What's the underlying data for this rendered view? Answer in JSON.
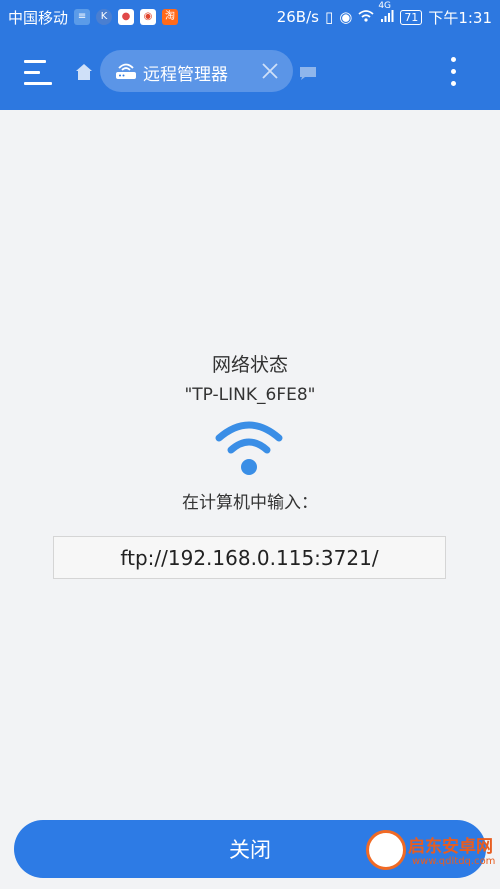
{
  "status_bar": {
    "carrier": "中国移动",
    "speed": "26B/s",
    "battery": "71",
    "time": "下午1:31",
    "network": "4G"
  },
  "toolbar": {
    "tab_title": "远程管理器"
  },
  "content": {
    "title": "网络状态",
    "ssid": "\"TP-LINK_6FE8\"",
    "instruction": "在计算机中输入：",
    "ftp_address": "ftp://192.168.0.115:3721/"
  },
  "footer": {
    "close_label": "关闭"
  },
  "watermark": {
    "name": "启东安卓网",
    "url": "www.qdltdq.com"
  },
  "colors": {
    "primary": "#2d78e0",
    "wifi": "#3a8ee6",
    "background": "#f2f3f5"
  },
  "icons": [
    "menu-icon",
    "home-icon",
    "router-icon",
    "close-icon",
    "chat-icon",
    "more-vert-icon",
    "wifi-icon"
  ]
}
